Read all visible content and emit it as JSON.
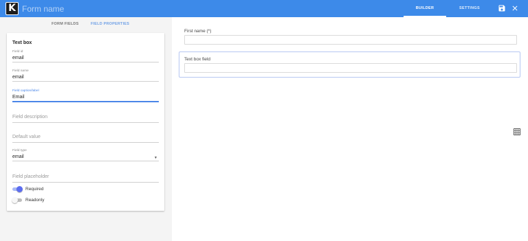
{
  "header": {
    "logo_letter": "K",
    "form_name_placeholder": "Form name",
    "tabs": [
      {
        "label": "BUILDER",
        "active": true
      },
      {
        "label": "SETTINGS",
        "active": false
      }
    ],
    "icons": [
      "save-icon",
      "close-icon"
    ],
    "bg_color": "#3d8ae9"
  },
  "left_panel": {
    "tabs": [
      {
        "label": "FORM FIELDS",
        "active": false
      },
      {
        "label": "FIELD PROPERTIES",
        "active": true
      }
    ],
    "card_title": "Text box",
    "fields": {
      "field_id": {
        "label": "Field id",
        "value": "email"
      },
      "field_name": {
        "label": "Field name",
        "value": "email"
      },
      "field_caption": {
        "label": "Field caption/label",
        "value": "Email"
      },
      "field_description": {
        "placeholder": "Field description"
      },
      "default_value": {
        "placeholder": "Default value"
      },
      "field_type": {
        "label": "Field type",
        "value": "email"
      },
      "field_placeholder": {
        "placeholder": "Field placeholder"
      }
    },
    "toggles": {
      "required": {
        "label": "Required",
        "on": true
      },
      "readonly": {
        "label": "Readonly",
        "on": false
      }
    },
    "accent_color": "#4a86e8"
  },
  "canvas": {
    "fields": [
      {
        "label": "First name (*)"
      },
      {
        "label": "Text box field",
        "selected": true
      }
    ],
    "icons": [
      "grid-icon"
    ]
  }
}
